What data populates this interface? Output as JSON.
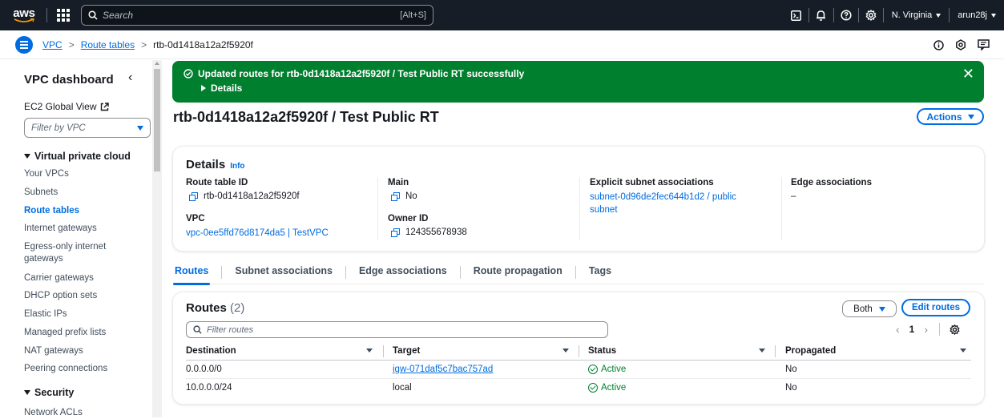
{
  "topnav": {
    "logo": "aws",
    "search_placeholder": "Search",
    "search_hint": "[Alt+S]",
    "region": "N. Virginia",
    "user": "arun28j",
    "icons": [
      "cloudshell-icon",
      "bell-icon",
      "help-icon",
      "gear-icon"
    ]
  },
  "breadcrumb": {
    "items": [
      "VPC",
      "Route tables",
      "rtb-0d1418a12a2f5920f"
    ],
    "icons": [
      "info-icon",
      "settings-icon",
      "feedback-icon"
    ]
  },
  "sidebar": {
    "title": "VPC dashboard",
    "ec2_link": "EC2 Global View",
    "filter_placeholder": "Filter by VPC",
    "section_vpc": "Virtual private cloud",
    "items": [
      "Your VPCs",
      "Subnets",
      "Route tables",
      "Internet gateways",
      "Egress-only internet gateways",
      "Carrier gateways",
      "DHCP option sets",
      "Elastic IPs",
      "Managed prefix lists",
      "NAT gateways",
      "Peering connections"
    ],
    "active_item": "Route tables",
    "section_security": "Security",
    "security_items": [
      "Network ACLs"
    ]
  },
  "flash": {
    "message": "Updated routes for rtb-0d1418a12a2f5920f / Test Public RT successfully",
    "details_label": "Details",
    "color": "#00802f"
  },
  "page": {
    "title": "rtb-0d1418a12a2f5920f / Test Public RT",
    "actions_label": "Actions"
  },
  "details": {
    "heading": "Details",
    "info_label": "Info",
    "route_table_id_label": "Route table ID",
    "route_table_id": "rtb-0d1418a12a2f5920f",
    "main_label": "Main",
    "main_value": "No",
    "explicit_label": "Explicit subnet associations",
    "explicit_value": "subnet-0d96de2fec644b1d2 / public subnet",
    "edge_label": "Edge associations",
    "edge_value": "–",
    "vpc_label": "VPC",
    "vpc_value": "vpc-0ee5ffd76d8174da5 | TestVPC",
    "owner_label": "Owner ID",
    "owner_value": "124355678938"
  },
  "tabs": [
    "Routes",
    "Subnet associations",
    "Edge associations",
    "Route propagation",
    "Tags"
  ],
  "routes": {
    "heading": "Routes",
    "count": "(2)",
    "filter_option": "Both",
    "edit_label": "Edit routes",
    "filter_placeholder": "Filter routes",
    "page": "1",
    "columns": [
      "Destination",
      "Target",
      "Status",
      "Propagated"
    ],
    "rows": [
      {
        "destination": "0.0.0.0/0",
        "target": "igw-071daf5c7bac757ad",
        "status": "Active",
        "propagated": "No"
      },
      {
        "destination": "10.0.0.0/24",
        "target": "local",
        "status": "Active",
        "propagated": "No"
      }
    ]
  },
  "colors": {
    "nav_bg": "#161d26",
    "link": "#006ce0",
    "success": "#00802f"
  }
}
